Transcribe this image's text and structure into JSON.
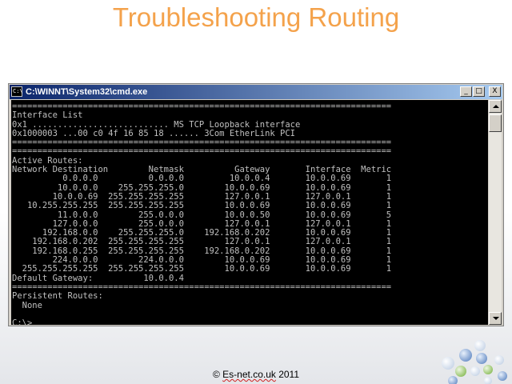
{
  "slide": {
    "title": "Troubleshooting Routing",
    "footer_prefix": "© ",
    "footer_brand": "Es-net.co.uk",
    "footer_suffix": " 2011"
  },
  "window": {
    "title": "C:\\WINNT\\System32\\cmd.exe",
    "icon_label": "C:\\",
    "buttons": {
      "minimize": "_",
      "maximize": "□",
      "close": "X"
    }
  },
  "console": {
    "output": "===========================================================================\nInterface List\n0x1 ........................... MS TCP Loopback interface\n0x1000003 ...00 c0 4f 16 85 18 ...... 3Com EtherLink PCI\n===========================================================================\n===========================================================================\nActive Routes:\nNetwork Destination        Netmask          Gateway       Interface  Metric\n          0.0.0.0          0.0.0.0         10.0.0.4       10.0.0.69       1\n         10.0.0.0    255.255.255.0        10.0.0.69       10.0.0.69       1\n        10.0.0.69  255.255.255.255        127.0.0.1       127.0.0.1       1\n   10.255.255.255  255.255.255.255        10.0.0.69       10.0.0.69       1\n         11.0.0.0        255.0.0.0        10.0.0.50       10.0.0.69       5\n        127.0.0.0        255.0.0.0        127.0.0.1       127.0.0.1       1\n      192.168.0.0    255.255.255.0    192.168.0.202       10.0.0.69       1\n    192.168.0.202  255.255.255.255        127.0.0.1       127.0.0.1       1\n    192.168.0.255  255.255.255.255    192.168.0.202       10.0.0.69       1\n        224.0.0.0        224.0.0.0        10.0.0.69       10.0.0.69       1\n  255.255.255.255  255.255.255.255        10.0.0.69       10.0.0.69       1\nDefault Gateway:          10.0.0.4\n===========================================================================\nPersistent Routes:\n  None\n\nC:\\>_"
  },
  "colors": {
    "title_orange": "#f4a24b",
    "titlebar_start": "#0a246a",
    "titlebar_end": "#a6caf0",
    "console_bg": "#000000",
    "console_text": "#c0c0c0"
  },
  "decoration": {
    "icon": "bubbles-logo-icon"
  }
}
